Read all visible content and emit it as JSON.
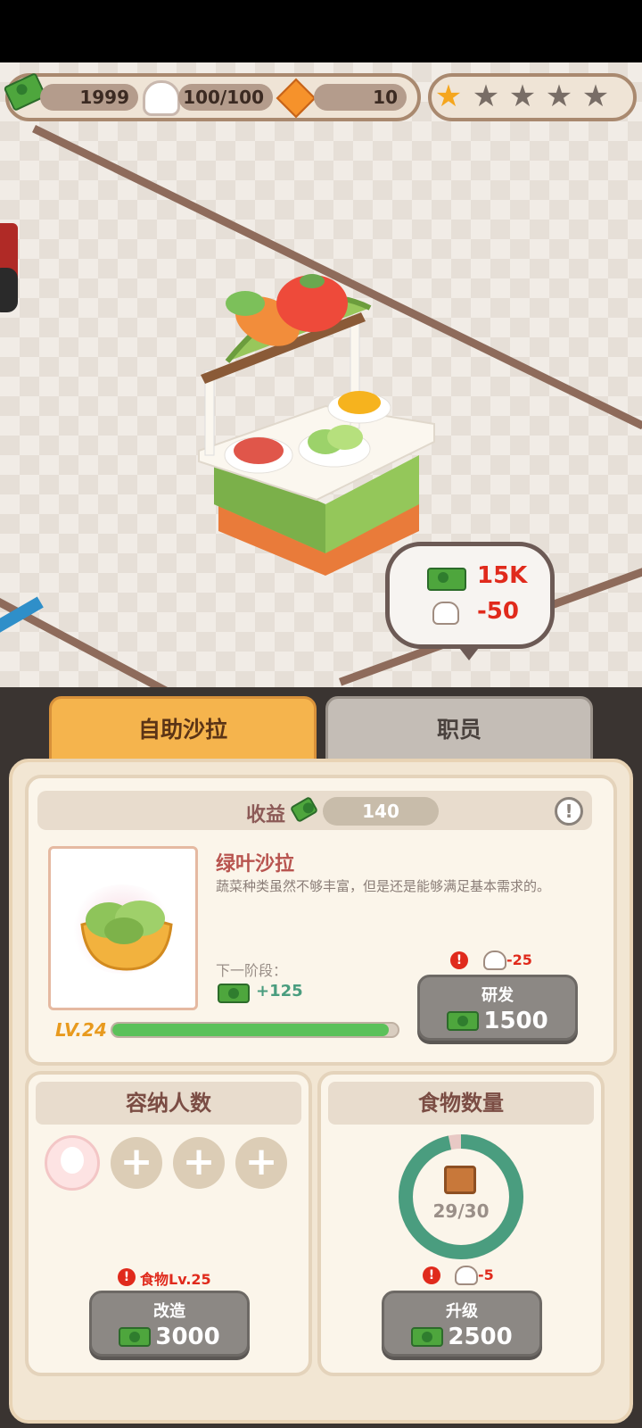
{
  "hud": {
    "cash": "1999",
    "chef_stamina": "100/100",
    "gems": "10",
    "stars_filled": 0.5,
    "stars_total": 5
  },
  "bubble": {
    "income": "15K",
    "stamina_cost": "-50"
  },
  "tabs": [
    {
      "label": "自助沙拉",
      "active": true
    },
    {
      "label": "职员",
      "active": false
    }
  ],
  "revenue": {
    "label": "收益",
    "value": "140",
    "info_icon": "!"
  },
  "dish": {
    "name": "绿叶沙拉",
    "description": "蔬菜种类虽然不够丰富，但是还是能够满足基本需求的。",
    "next_stage_label": "下一阶段：",
    "next_stage_bonus": "+125",
    "level": "LV.24",
    "level_progress": 0.97
  },
  "research": {
    "stamina_cost": "-25",
    "label": "研发",
    "price": "1500"
  },
  "capacity": {
    "title": "容纳人数",
    "slots_filled": 1,
    "requirement": "食物Lv.25",
    "button_label": "改造",
    "price": "3000"
  },
  "food": {
    "title": "食物数量",
    "count": "29/30",
    "fill_fraction": 0.967,
    "stamina_cost": "-5",
    "button_label": "升级",
    "price": "2500"
  },
  "colors": {
    "accent_orange": "#f5b44d",
    "green": "#4ea63d",
    "teal": "#4a9d7f",
    "red": "#e02a1c"
  }
}
